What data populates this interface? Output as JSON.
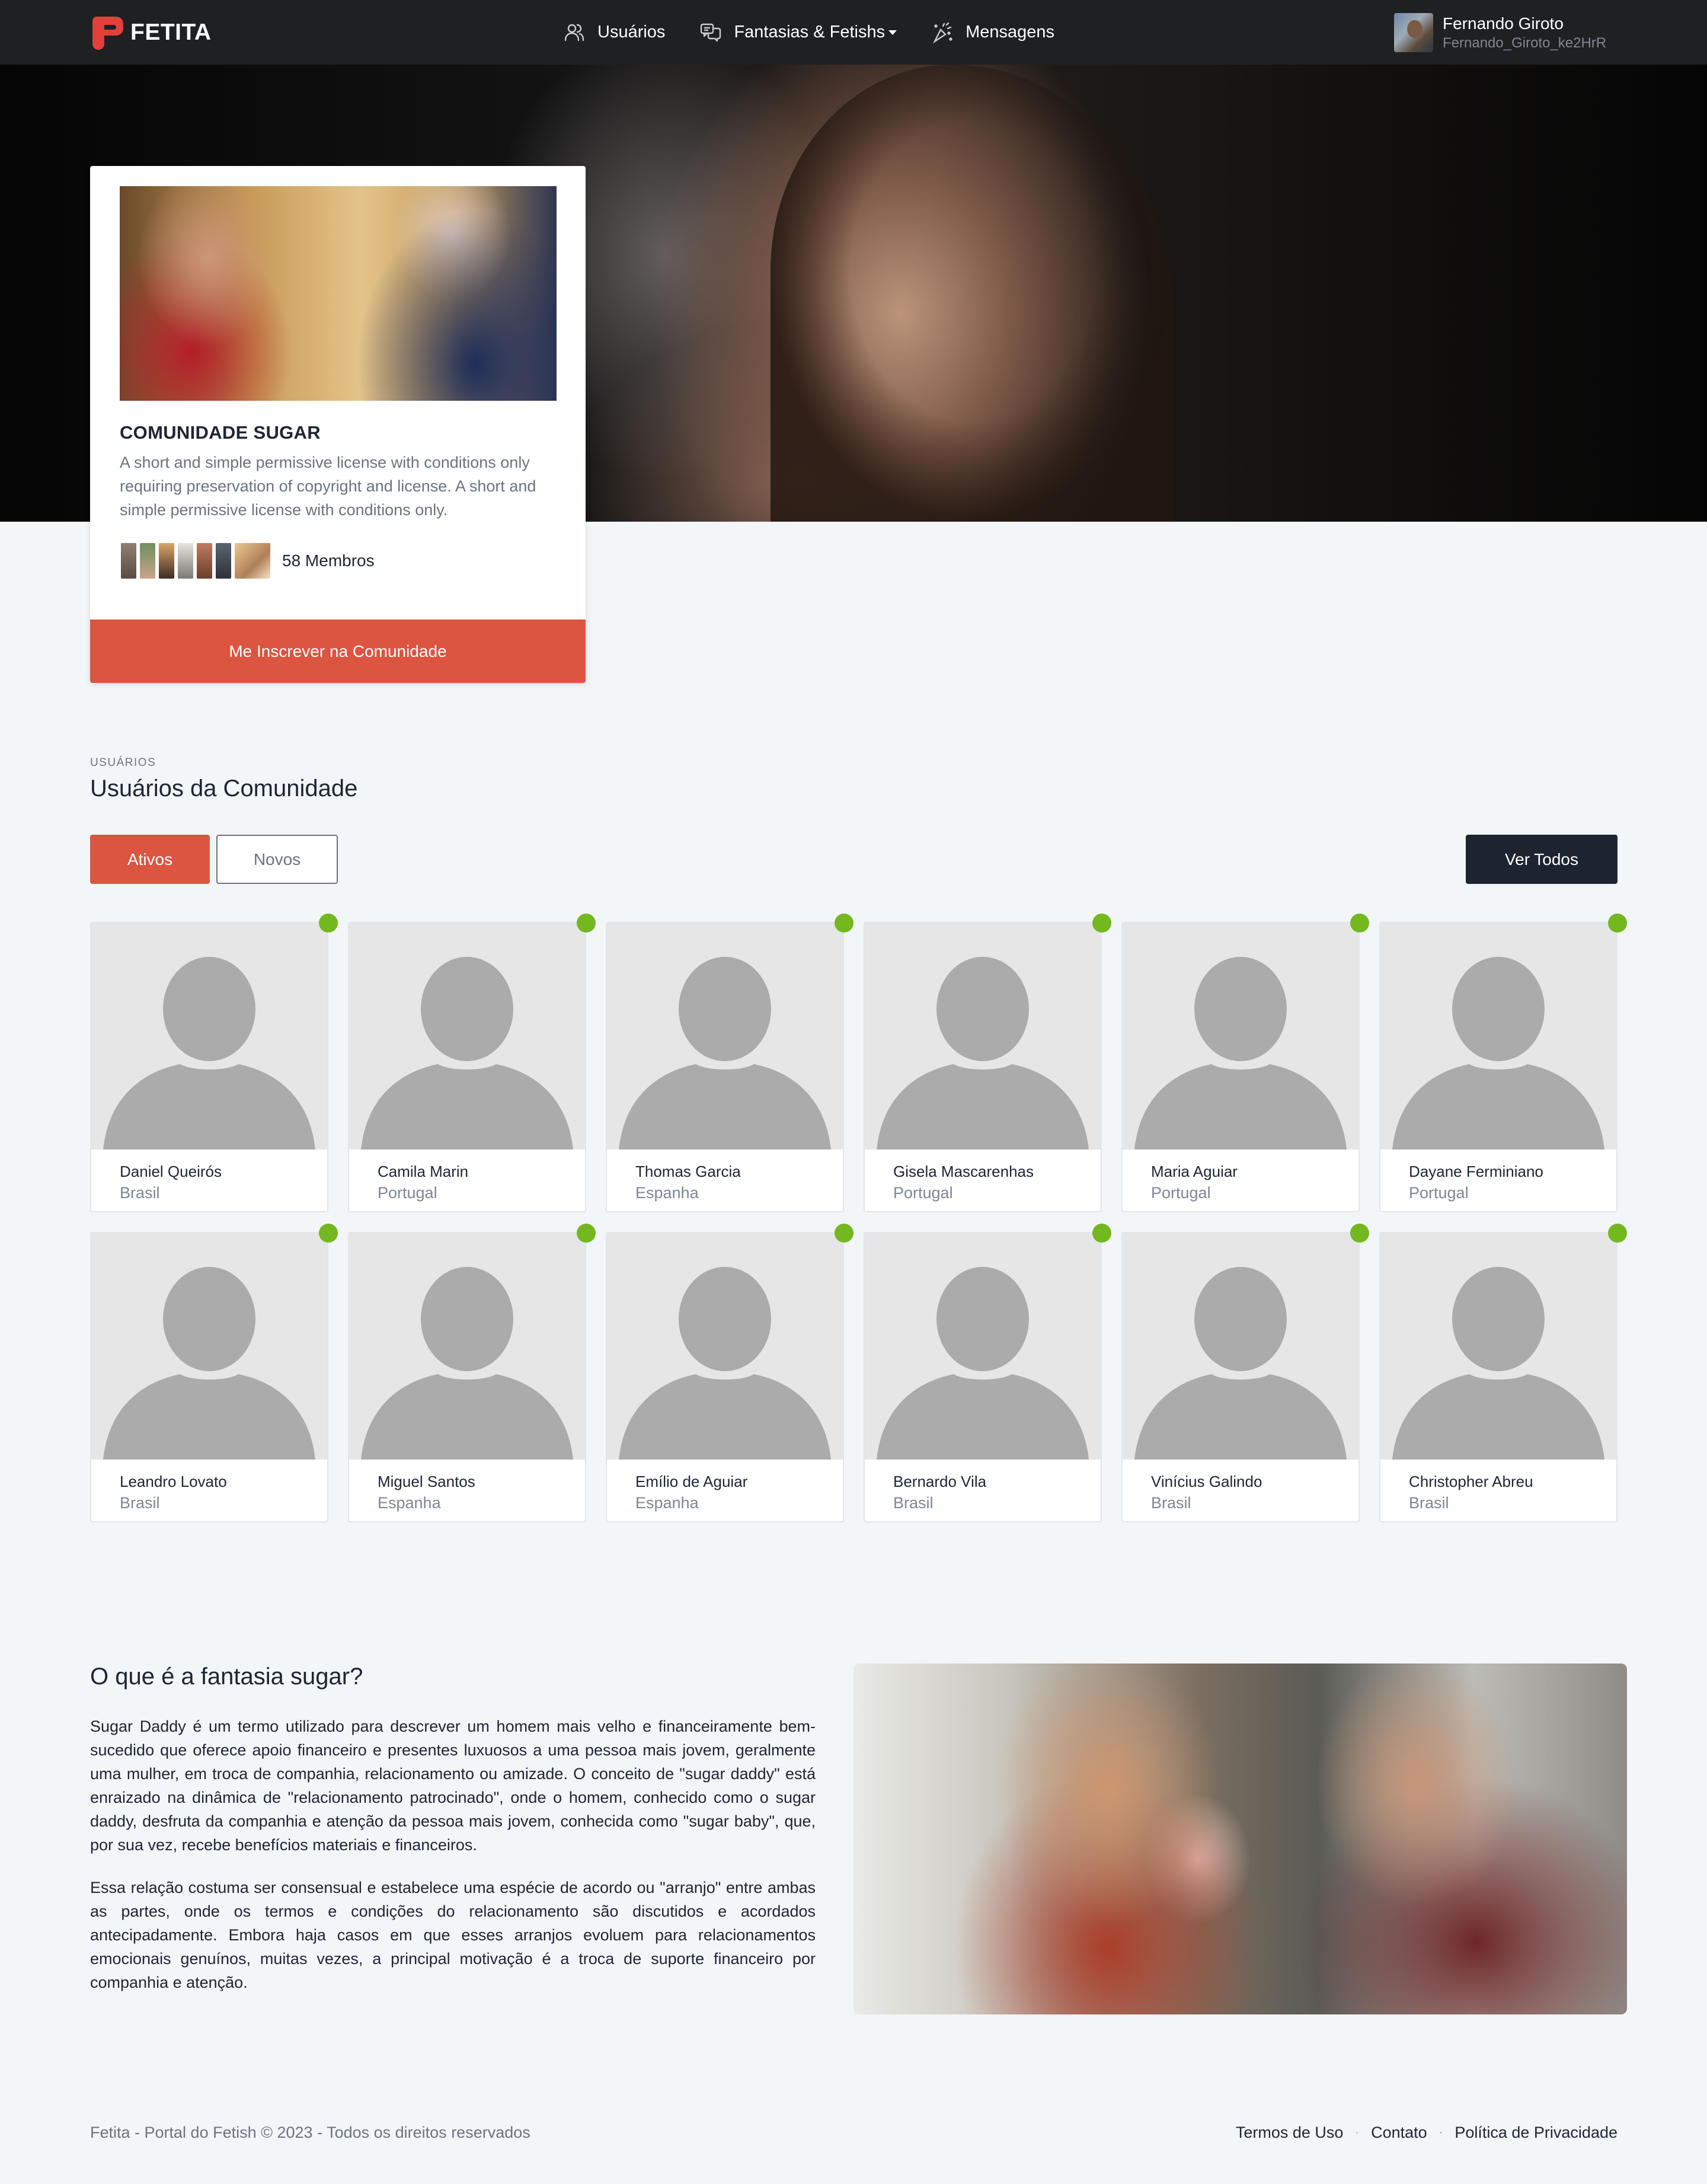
{
  "brand": {
    "name": "FETITA",
    "accent": "#e2403b"
  },
  "nav": {
    "items": [
      {
        "label": "Usuários",
        "icon": "users-icon"
      },
      {
        "label": "Fantasias & Fetishs",
        "icon": "chat-bubbles-icon",
        "has_dropdown": true
      },
      {
        "label": "Mensagens",
        "icon": "sparkle-icon"
      }
    ]
  },
  "user": {
    "name": "Fernando Giroto",
    "handle": "Fernando_Giroto_ke2HrR"
  },
  "community": {
    "name": "COMUNIDADE SUGAR",
    "description": "A short and simple permissive license with conditions only requiring preservation of copyright and license. A short and simple permissive license with conditions only.",
    "members_label": "58 Membros",
    "join_label": "Me Inscrever na Comunidade",
    "join_color": "#db5541"
  },
  "users_section": {
    "eyebrow": "USUÁRIOS",
    "title": "Usuários da Comunidade",
    "tabs": [
      {
        "label": "Ativos",
        "active": true
      },
      {
        "label": "Novos",
        "active": false
      }
    ],
    "see_all_label": "Ver Todos",
    "online_color": "#72b81e",
    "users": [
      {
        "name": "Daniel Queirós",
        "country": "Brasil"
      },
      {
        "name": "Camila Marin",
        "country": "Portugal"
      },
      {
        "name": "Thomas Garcia",
        "country": "Espanha"
      },
      {
        "name": "Gisela Mascarenhas",
        "country": "Portugal"
      },
      {
        "name": "Maria Aguiar",
        "country": "Portugal"
      },
      {
        "name": "Dayane Ferminiano",
        "country": "Portugal"
      },
      {
        "name": "Leandro Lovato",
        "country": "Brasil"
      },
      {
        "name": "Miguel Santos",
        "country": "Espanha"
      },
      {
        "name": "Emílio de Aguiar",
        "country": "Espanha"
      },
      {
        "name": "Bernardo Vila",
        "country": "Brasil"
      },
      {
        "name": "Vinícius Galindo",
        "country": "Brasil"
      },
      {
        "name": "Christopher Abreu",
        "country": "Brasil"
      }
    ]
  },
  "about": {
    "title": "O que é a fantasia sugar?",
    "paragraphs": [
      "Sugar Daddy é um termo utilizado para descrever um homem mais velho e financeiramente bem-sucedido que oferece apoio financeiro e presentes luxuosos a uma pessoa mais jovem, geralmente uma mulher, em troca de companhia, relacionamento ou amizade. O conceito de \"sugar daddy\" está enraizado na dinâmica de \"relacionamento patrocinado\", onde o homem, conhecido como o sugar daddy, desfruta da companhia e atenção da pessoa mais jovem, conhecida como \"sugar baby\", que, por sua vez, recebe benefícios materiais e financeiros.",
      "Essa relação costuma ser consensual e estabelece uma espécie de acordo ou \"arranjo\" entre ambas as partes, onde os termos e condições do relacionamento são discutidos e acordados antecipadamente. Embora haja casos em que esses arranjos evoluem para relacionamentos emocionais genuínos, muitas vezes, a principal motivação é a troca de suporte financeiro por companhia e atenção."
    ]
  },
  "footer": {
    "copyright": "Fetita - Portal do Fetish © 2023 - Todos os direitos reservados",
    "links": [
      "Termos de Uso",
      "Contato",
      "Política de Privacidade"
    ],
    "separator": "·"
  }
}
